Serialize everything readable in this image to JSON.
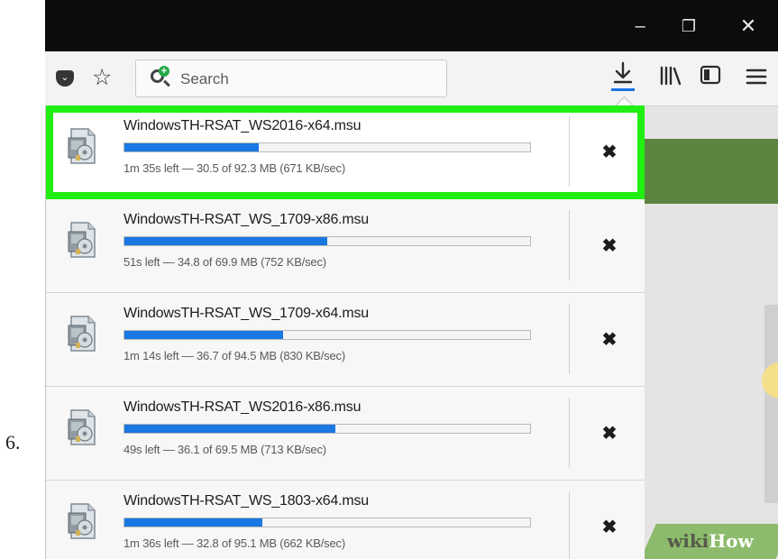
{
  "step_number": "6.",
  "toolbar": {
    "search_placeholder": "Search",
    "pocket_icon": "pocket-icon",
    "bookmark_icon": "star-icon",
    "downloads_icon": "download-arrow-icon",
    "library_icon": "library-icon",
    "sidebar_icon": "sidebar-icon",
    "menu_icon": "hamburger-menu-icon"
  },
  "window_controls": {
    "minimize": "–",
    "restore": "❐",
    "close": "✕"
  },
  "downloads": [
    {
      "filename": "WindowsTH-RSAT_WS2016-x64.msu",
      "status": "1m 35s left — 30.5 of 92.3 MB (671 KB/sec)",
      "progress": 0.33,
      "highlighted": true
    },
    {
      "filename": "WindowsTH-RSAT_WS_1709-x86.msu",
      "status": "51s left — 34.8 of 69.9 MB (752 KB/sec)",
      "progress": 0.5,
      "highlighted": false
    },
    {
      "filename": "WindowsTH-RSAT_WS_1709-x64.msu",
      "status": "1m 14s left — 36.7 of 94.5 MB (830 KB/sec)",
      "progress": 0.39,
      "highlighted": false
    },
    {
      "filename": "WindowsTH-RSAT_WS2016-x86.msu",
      "status": "49s left — 36.1 of 69.5 MB (713 KB/sec)",
      "progress": 0.52,
      "highlighted": false
    },
    {
      "filename": "WindowsTH-RSAT_WS_1803-x64.msu",
      "status": "1m 36s left — 32.8 of 95.1 MB (662 KB/sec)",
      "progress": 0.34,
      "highlighted": false
    }
  ],
  "cancel_glyph": "✖",
  "watermark": {
    "part1": "wiki",
    "part2": "How"
  },
  "colors": {
    "highlight_border": "#21ee11",
    "progress_fill": "#1a78e2",
    "download_indicator": "#1a73e8",
    "page_header_green": "#5c8440"
  }
}
